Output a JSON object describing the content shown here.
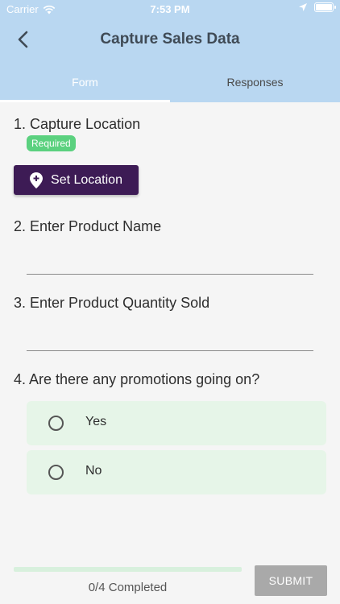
{
  "status_bar": {
    "carrier": "Carrier",
    "time": "7:53 PM"
  },
  "header": {
    "title": "Capture Sales Data",
    "back_icon": "chevron-left-icon"
  },
  "tabs": [
    {
      "label": "Form",
      "active": true
    },
    {
      "label": "Responses",
      "active": false
    }
  ],
  "questions": {
    "q1": {
      "label": "1. Capture Location",
      "badge": "Required",
      "button_label": "Set Location",
      "button_icon": "add-location-pin-icon"
    },
    "q2": {
      "label": "2. Enter Product Name",
      "value": ""
    },
    "q3": {
      "label": "3. Enter Product Quantity Sold",
      "value": ""
    },
    "q4": {
      "label": "4. Are there any promotions going on?",
      "options": [
        "Yes",
        "No"
      ],
      "selected": null
    }
  },
  "footer": {
    "progress_text": "0/4 Completed",
    "progress_value": 0,
    "submit_label": "SUBMIT"
  },
  "colors": {
    "header_bg": "#b9d7f1",
    "primary_button": "#3d1b55",
    "badge_green": "#5bd17f",
    "option_bg": "#e6f5e8",
    "submit_disabled": "#a9a9a9"
  }
}
